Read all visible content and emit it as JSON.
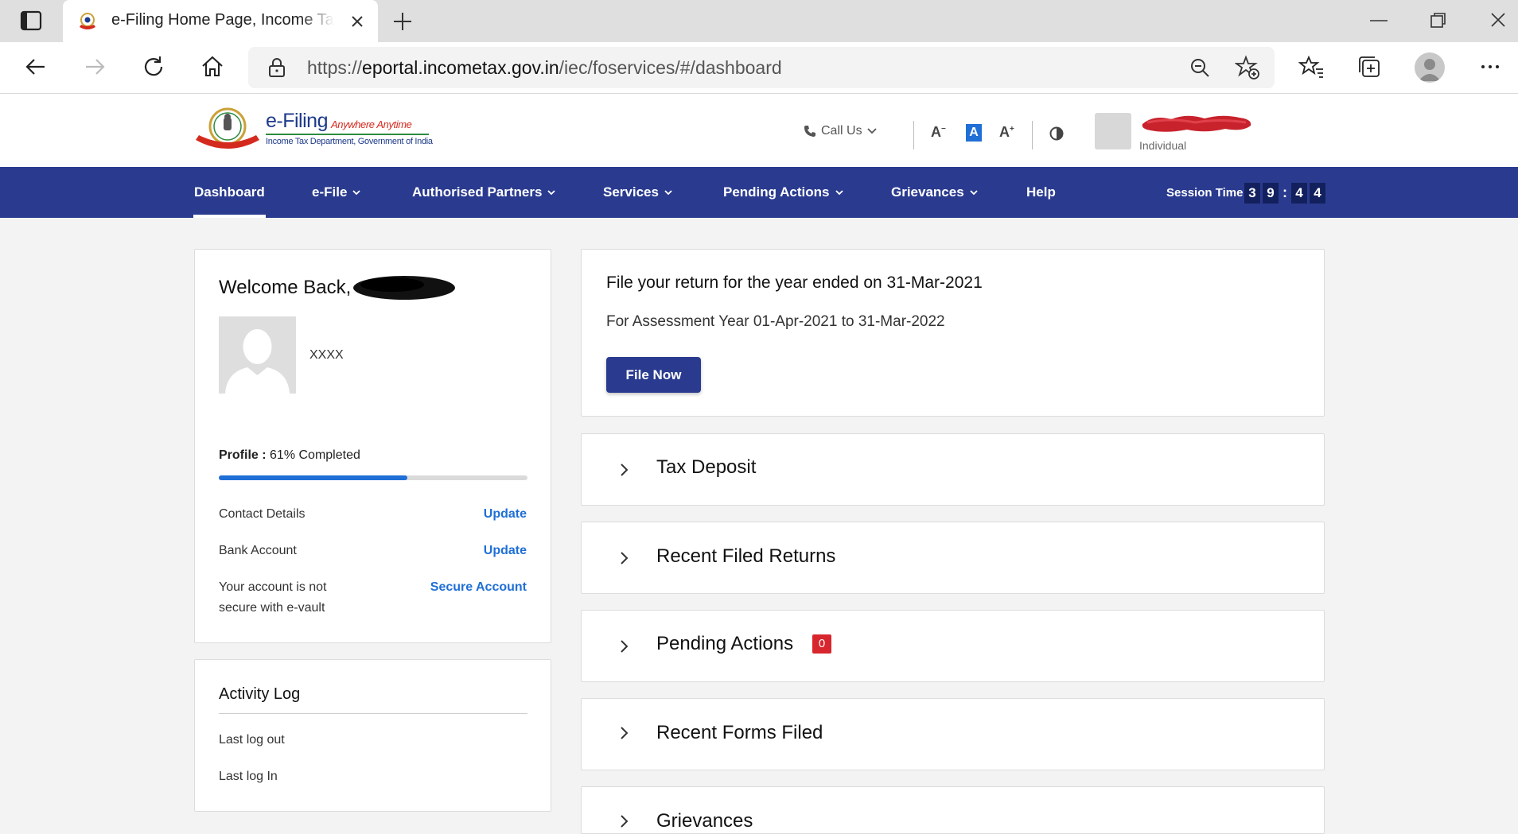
{
  "browser": {
    "tab_title": "e-Filing Home Page, Income Tax Department, Government of India",
    "url_scheme": "https://",
    "url_host": "eportal.incometax.gov.in",
    "url_path": "/iec/foservices/#/dashboard"
  },
  "header": {
    "logo_title": "e-Filing",
    "logo_tagline": "Anywhere Anytime",
    "logo_subtitle": "Income Tax Department, Government of India",
    "call_us": "Call Us",
    "font_decrease": "A",
    "font_normal": "A",
    "font_increase": "A",
    "user_type": "Individual"
  },
  "nav": {
    "items": [
      {
        "label": "Dashboard",
        "dropdown": false
      },
      {
        "label": "e-File",
        "dropdown": true
      },
      {
        "label": "Authorised Partners",
        "dropdown": true
      },
      {
        "label": "Services",
        "dropdown": true
      },
      {
        "label": "Pending Actions",
        "dropdown": true
      },
      {
        "label": "Grievances",
        "dropdown": true
      },
      {
        "label": "Help",
        "dropdown": false
      }
    ],
    "session_label": "Session Time",
    "session_digits": [
      "3",
      "9",
      "4",
      "4"
    ],
    "session_separator": ":"
  },
  "profile": {
    "welcome": "Welcome Back,",
    "pan": "XXXX",
    "profile_label": "Profile :",
    "profile_percent_text": "61% Completed",
    "profile_progress": 0.61,
    "rows": [
      {
        "label": "Contact Details",
        "link": "Update"
      },
      {
        "label": "Bank Account",
        "link": "Update"
      },
      {
        "label_line1": "Your account is not",
        "label_line2": "secure with e-vault",
        "link": "Secure Account"
      }
    ]
  },
  "activity": {
    "title": "Activity Log",
    "items": [
      "Last log out",
      "Last log In"
    ]
  },
  "file_return": {
    "title": "File your return for the year ended on 31-Mar-2021",
    "subtitle": "For Assessment Year 01-Apr-2021 to 31-Mar-2022",
    "button": "File Now"
  },
  "sections": [
    {
      "title": "Tax Deposit"
    },
    {
      "title": "Recent Filed Returns"
    },
    {
      "title": "Pending Actions",
      "badge": "0"
    },
    {
      "title": "Recent Forms Filed"
    },
    {
      "title": "Grievances"
    }
  ],
  "colors": {
    "nav_bg": "#2a3b8f",
    "link": "#1f6fd6",
    "badge": "#d7262d"
  }
}
